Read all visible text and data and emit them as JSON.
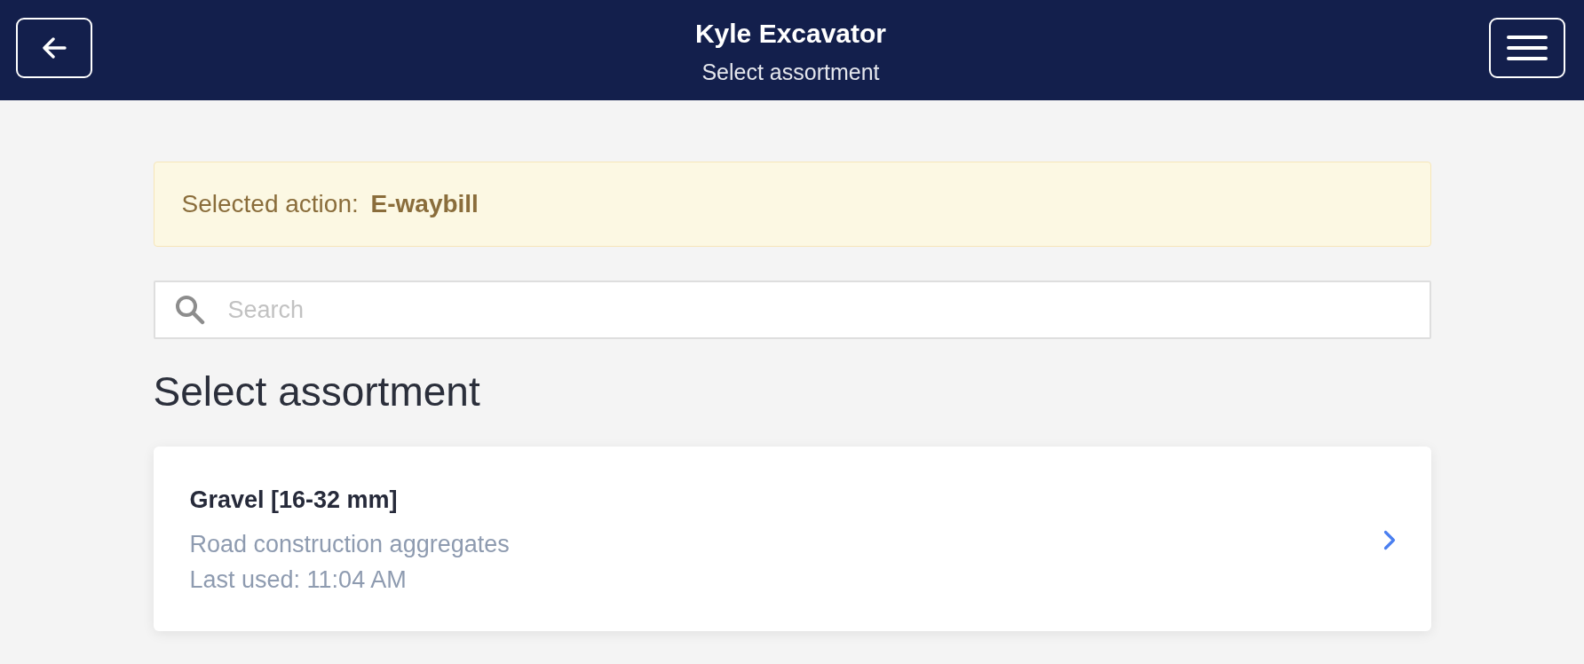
{
  "header": {
    "title": "Kyle Excavator",
    "subtitle": "Select assortment"
  },
  "notice": {
    "text": "Selected action: **E-waybill**"
  },
  "search": {
    "placeholder": "Search"
  },
  "section_title": "Select assortment",
  "assortments": [
    {
      "name": "Gravel [16-32 mm]",
      "description": "Road construction aggregates",
      "last_used": "Last used: 11:04 AM"
    }
  ]
}
